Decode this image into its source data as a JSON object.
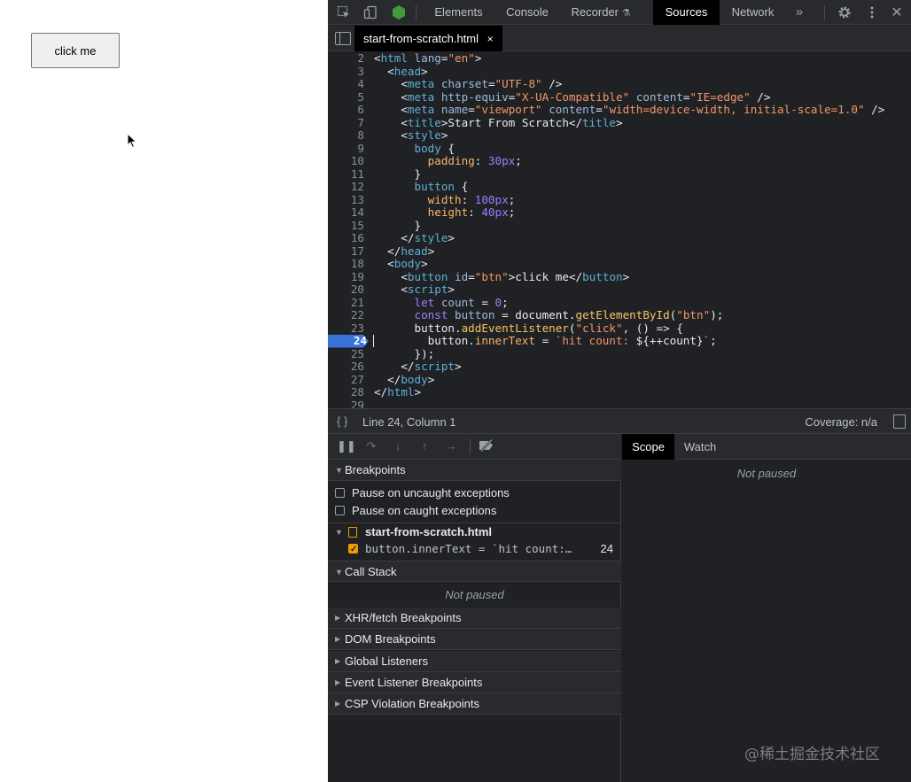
{
  "page": {
    "button_label": "click me"
  },
  "devtools": {
    "tabs": [
      "Elements",
      "Console",
      "Recorder",
      "Sources",
      "Network"
    ],
    "active_tab": "Sources",
    "more_tabs_icon": "»",
    "file_tab": "start-from-scratch.html",
    "file_tab_close": "×"
  },
  "editor": {
    "breakpoint_line": 24,
    "lines": [
      {
        "n": "2",
        "html": "<span class=\"t-txt\">&lt;</span><span class=\"t-tag\">html</span> <span class=\"t-attr\">lang</span>=<span class=\"t-str\">\"en\"</span><span class=\"t-txt\">&gt;</span>"
      },
      {
        "n": "3",
        "html": "  &lt;<span class=\"t-tag\">head</span>&gt;"
      },
      {
        "n": "4",
        "html": "    &lt;<span class=\"t-tag\">meta</span> <span class=\"t-attr\">charset</span>=<span class=\"t-str\">\"UTF-8\"</span> /&gt;"
      },
      {
        "n": "5",
        "html": "    &lt;<span class=\"t-tag\">meta</span> <span class=\"t-attr\">http-equiv</span>=<span class=\"t-str\">\"X-UA-Compatible\"</span> <span class=\"t-attr\">content</span>=<span class=\"t-str\">\"IE=edge\"</span> /&gt;"
      },
      {
        "n": "6",
        "html": "    &lt;<span class=\"t-tag\">meta</span> <span class=\"t-attr\">name</span>=<span class=\"t-str\">\"viewport\"</span> <span class=\"t-attr\">content</span>=<span class=\"t-str\">\"width=device-width, initial-scale=1.0\"</span> /&gt;"
      },
      {
        "n": "7",
        "html": "    &lt;<span class=\"t-tag\">title</span>&gt;Start From Scratch&lt;/<span class=\"t-tag\">title</span>&gt;"
      },
      {
        "n": "8",
        "html": "    &lt;<span class=\"t-tag\">style</span>&gt;"
      },
      {
        "n": "9",
        "html": "      <span class=\"t-tag\">body</span> {"
      },
      {
        "n": "10",
        "html": "        <span class=\"t-prop\">padding</span>: <span class=\"t-num\">30px</span>;"
      },
      {
        "n": "11",
        "html": "      }"
      },
      {
        "n": "12",
        "html": "      <span class=\"t-tag\">button</span> {"
      },
      {
        "n": "13",
        "html": "        <span class=\"t-prop\">width</span>: <span class=\"t-num\">100px</span>;"
      },
      {
        "n": "14",
        "html": "        <span class=\"t-prop\">height</span>: <span class=\"t-num\">40px</span>;"
      },
      {
        "n": "15",
        "html": "      }"
      },
      {
        "n": "16",
        "html": "    &lt;/<span class=\"t-tag\">style</span>&gt;"
      },
      {
        "n": "17",
        "html": "  &lt;/<span class=\"t-tag\">head</span>&gt;"
      },
      {
        "n": "18",
        "html": "  &lt;<span class=\"t-tag\">body</span>&gt;"
      },
      {
        "n": "19",
        "html": "    &lt;<span class=\"t-tag\">button</span> <span class=\"t-attr\">id</span>=<span class=\"t-str\">\"btn\"</span>&gt;click me&lt;/<span class=\"t-tag\">button</span>&gt;"
      },
      {
        "n": "20",
        "html": "    &lt;<span class=\"t-tag\">script</span>&gt;"
      },
      {
        "n": "21",
        "html": "      <span class=\"t-kw\">let</span> <span class=\"t-var\">count</span> = <span class=\"t-num\">0</span>;"
      },
      {
        "n": "22",
        "html": "      <span class=\"t-kw\">const</span> <span class=\"t-var\">button</span> = document.<span class=\"t-fn\">getElementById</span>(<span class=\"t-str\">\"btn\"</span>);"
      },
      {
        "n": "23",
        "html": "      button.<span class=\"t-fn\">addEventListener</span>(<span class=\"t-str\">\"click\"</span>, () =&gt; {"
      },
      {
        "n": "24",
        "html": "        button.<span class=\"t-prop\">innerText</span> = <span class=\"t-str\">`hit count: </span>${++count}<span class=\"t-str\">`</span>;"
      },
      {
        "n": "25",
        "html": "      });"
      },
      {
        "n": "26",
        "html": "    &lt;/<span class=\"t-tag\">script</span>&gt;"
      },
      {
        "n": "27",
        "html": "  &lt;/<span class=\"t-tag\">body</span>&gt;"
      },
      {
        "n": "28",
        "html": "&lt;/<span class=\"t-tag\">html</span>&gt;"
      },
      {
        "n": "29",
        "html": ""
      }
    ]
  },
  "status": {
    "braces": "{ }",
    "cursor_position": "Line 24, Column 1",
    "coverage": "Coverage: n/a"
  },
  "breakpoints_panel": {
    "breakpoints_header": "Breakpoints",
    "pause_uncaught": "Pause on uncaught exceptions",
    "pause_caught": "Pause on caught exceptions",
    "file_name": "start-from-scratch.html",
    "bp_code": "button.innerText = `hit count:…",
    "bp_line": "24",
    "call_stack_header": "Call Stack",
    "not_paused": "Not paused",
    "collapsed_sections": [
      "XHR/fetch Breakpoints",
      "DOM Breakpoints",
      "Global Listeners",
      "Event Listener Breakpoints",
      "CSP Violation Breakpoints"
    ]
  },
  "scope_panel": {
    "tabs": [
      "Scope",
      "Watch"
    ],
    "active_tab": "Scope",
    "not_paused": "Not paused"
  },
  "watermark": "@稀土掘金技术社区"
}
